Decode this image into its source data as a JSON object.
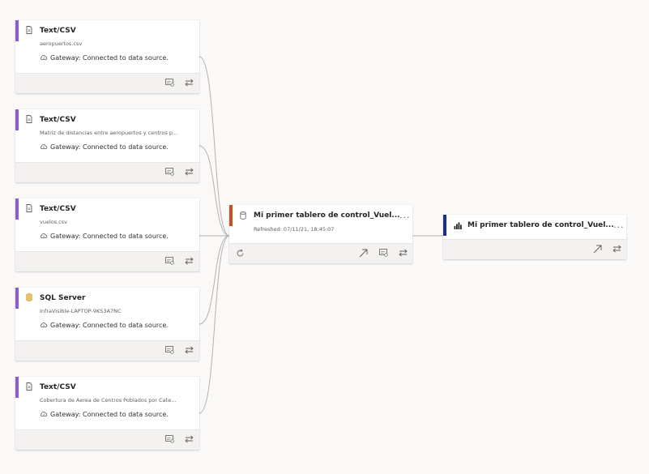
{
  "sources": [
    {
      "type": "Text/CSV",
      "detail": "aeropuertos.csv",
      "gateway": "Gateway: Connected to data source.",
      "icon": "file-icon",
      "accent": "#8a5cd6"
    },
    {
      "type": "Text/CSV",
      "detail": "Matriz de distancias entre aeropuertos y centros p...",
      "gateway": "Gateway: Connected to data source.",
      "icon": "file-icon",
      "accent": "#8a5cd6"
    },
    {
      "type": "Text/CSV",
      "detail": "vuelos.csv",
      "gateway": "Gateway: Connected to data source.",
      "icon": "file-icon",
      "accent": "#8a5cd6"
    },
    {
      "type": "SQL Server",
      "detail": "InfraVisible-LAPTOP-9KS3A7NC",
      "gateway": "Gateway: Connected to data source.",
      "icon": "database-icon",
      "accent": "#8a5cd6"
    },
    {
      "type": "Text/CSV",
      "detail": "Cobertura de Aerea de Centros Poblados por Cate...",
      "gateway": "Gateway: Connected to data source.",
      "icon": "file-icon",
      "accent": "#8a5cd6"
    }
  ],
  "dataset": {
    "title": "Mi primer tablero de control_Vuel...",
    "refreshed": "Refreshed: 07/11/21, 18:45:07",
    "more": "···",
    "accent": "#c8501e"
  },
  "report": {
    "title": "Mi primer tablero de control_Vuel...",
    "more": "···",
    "accent": "#1d2e8c"
  },
  "colors": {
    "connector": "#b3b0ad",
    "footer": "#f3f2f1",
    "icon": "#605e5c"
  }
}
